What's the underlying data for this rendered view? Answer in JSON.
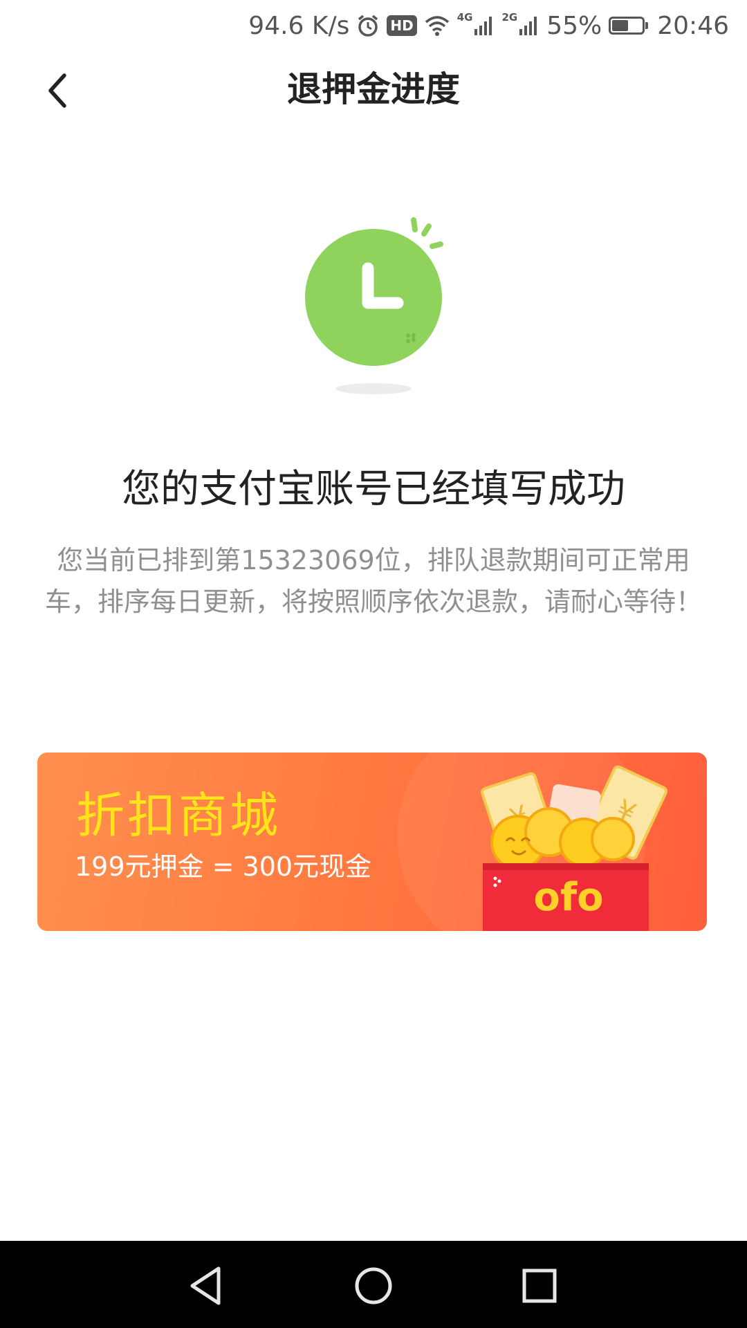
{
  "status_bar": {
    "net_speed": "94.6 K/s",
    "hd_label": "HD",
    "net_4g": "4G",
    "net_2g": "2G",
    "battery_percent": "55%",
    "battery_level": 0.55,
    "time": "20:46"
  },
  "nav": {
    "title": "退押金进度"
  },
  "status": {
    "headline": "您的支付宝账号已经填写成功",
    "detail": "您当前已排到第15323069位，排队退款期间可正常用车，排序每日更新，将按照顺序依次退款，请耐心等待！"
  },
  "banner": {
    "title": "折扣商城",
    "subtitle": "199元押金 = 300元现金",
    "brand": "ofo"
  },
  "colors": {
    "clock_green": "#8fd35d",
    "banner_orange": "#ff7a40",
    "banner_title": "#ffe41a",
    "envelope_red": "#f02b3a"
  }
}
